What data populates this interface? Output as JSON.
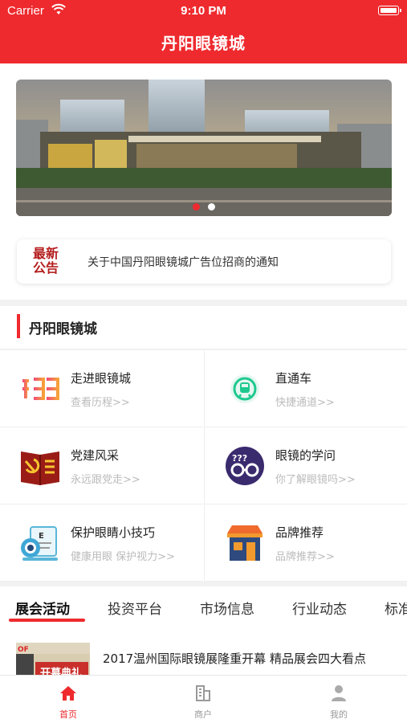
{
  "status_bar": {
    "carrier": "Carrier",
    "time": "9:10 PM"
  },
  "nav": {
    "title": "丹阳眼镜城"
  },
  "banner": {
    "page_count": 2,
    "active_page": 1
  },
  "notice": {
    "badge_line1": "最新",
    "badge_line2": "公告",
    "text": "关于中国丹阳眼镜城广告位招商的通知"
  },
  "section": {
    "title": "丹阳眼镜城"
  },
  "grid": [
    {
      "name": "走进眼镜城",
      "sub": "查看历程>>",
      "icon": "history-logo-icon"
    },
    {
      "name": "直通车",
      "sub": "快捷通道>>",
      "icon": "express-train-icon"
    },
    {
      "name": "党建风采",
      "sub": "永远跟党走>>",
      "icon": "party-building-icon"
    },
    {
      "name": "眼镜的学问",
      "sub": "你了解眼镜吗>>",
      "icon": "glasses-question-icon"
    },
    {
      "name": "保护眼睛小技巧",
      "sub": "健康用眼 保护视力>>",
      "icon": "eye-care-icon"
    },
    {
      "name": "品牌推荐",
      "sub": "品牌推荐>>",
      "icon": "shop-icon"
    }
  ],
  "tabs": [
    "展会活动",
    "投资平台",
    "市场信息",
    "行业动态",
    "标准"
  ],
  "article": {
    "headline": "2017温州国际眼镜展隆重开幕 精品展会四大看点",
    "thumb_text": "开幕典礼"
  },
  "tabbar": [
    {
      "label": "首页",
      "icon": "home-icon",
      "active": true
    },
    {
      "label": "商户",
      "icon": "merchant-icon",
      "active": false
    },
    {
      "label": "我的",
      "icon": "profile-icon",
      "active": false
    }
  ],
  "colors": {
    "brand_red": "#ee2a2e",
    "muted_text": "#bbbbbb"
  }
}
